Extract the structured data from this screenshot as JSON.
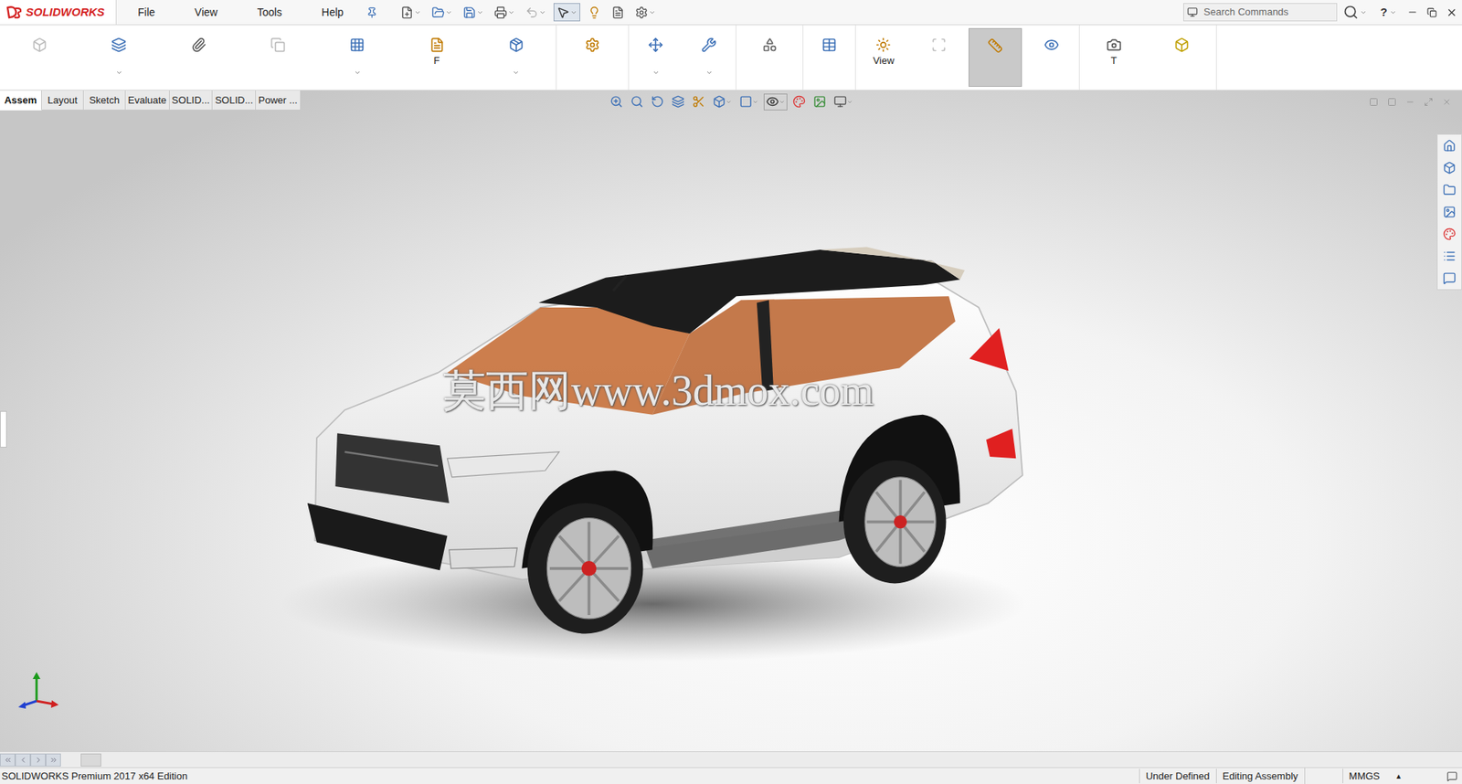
{
  "app": {
    "logo": "SOLIDWORKS"
  },
  "menu": [
    "File",
    "View",
    "Tools",
    "Help"
  ],
  "quick_access": [
    {
      "dropdown": true,
      "selected": false,
      "disabled": false
    },
    {
      "dropdown": true,
      "selected": false,
      "disabled": false
    },
    {
      "dropdown": true,
      "selected": false,
      "disabled": false
    },
    {
      "dropdown": true,
      "selected": false,
      "disabled": false
    },
    {
      "dropdown": true,
      "selected": false,
      "disabled": true
    },
    {
      "dropdown": true,
      "selected": true,
      "disabled": false
    },
    {
      "dropdown": false,
      "selected": false,
      "disabled": false
    },
    {
      "dropdown": false,
      "selected": false,
      "disabled": false
    },
    {
      "dropdown": true,
      "selected": false,
      "disabled": false
    }
  ],
  "search": {
    "placeholder": "Search Commands"
  },
  "help": "?",
  "ribbon": {
    "groups": [
      [
        {
          "dropdown": false,
          "selected": false,
          "disabled": true
        },
        {
          "dropdown": true,
          "selected": false,
          "disabled": false
        },
        {
          "dropdown": false,
          "selected": false,
          "disabled": false
        },
        {
          "dropdown": false,
          "selected": false,
          "disabled": true
        },
        {
          "dropdown": true,
          "selected": false,
          "disabled": false
        },
        {
          "label": "F",
          "dropdown": false,
          "selected": false,
          "disabled": false
        },
        {
          "dropdown": true,
          "selected": false,
          "disabled": false
        }
      ],
      [
        {
          "dropdown": false,
          "selected": false,
          "disabled": false
        }
      ],
      [
        {
          "dropdown": true,
          "selected": false,
          "disabled": false
        },
        {
          "dropdown": true,
          "selected": false,
          "disabled": false
        }
      ],
      [
        {
          "dropdown": false,
          "selected": false,
          "disabled": false
        }
      ],
      [
        {
          "dropdown": false,
          "selected": false,
          "disabled": false
        }
      ],
      [
        {
          "label": "View",
          "dropdown": false,
          "selected": false,
          "disabled": false
        },
        {
          "dropdown": false,
          "selected": false,
          "disabled": true
        },
        {
          "dropdown": false,
          "selected": true,
          "disabled": false
        },
        {
          "dropdown": false,
          "selected": false,
          "disabled": false
        }
      ],
      [
        {
          "label": "T",
          "dropdown": false,
          "selected": false,
          "disabled": false
        },
        {
          "dropdown": false,
          "selected": false,
          "disabled": false
        }
      ]
    ]
  },
  "tabs": [
    {
      "label": "Assem",
      "selected": true
    },
    {
      "label": "Layout",
      "selected": false
    },
    {
      "label": "Sketch",
      "selected": false
    },
    {
      "label": "Evaluate",
      "selected": false
    },
    {
      "label": "SOLID...",
      "selected": false
    },
    {
      "label": "SOLID...",
      "selected": false
    },
    {
      "label": "Power ...",
      "selected": false
    }
  ],
  "heads_up": [
    {
      "dropdown": false,
      "selected": false
    },
    {
      "dropdown": false,
      "selected": false
    },
    {
      "dropdown": false,
      "selected": false
    },
    {
      "dropdown": false,
      "selected": false
    },
    {
      "dropdown": false,
      "selected": false
    },
    {
      "dropdown": true,
      "selected": false
    },
    {
      "dropdown": true,
      "selected": false
    },
    {
      "dropdown": true,
      "selected": true
    },
    {
      "dropdown": false,
      "selected": false
    },
    {
      "dropdown": false,
      "selected": false
    },
    {
      "dropdown": true,
      "selected": false
    }
  ],
  "viewport": {
    "watermark": "莫西网www.3dmox.com"
  },
  "status_bar": {
    "edition": "SOLIDWORKS Premium 2017 x64 Edition",
    "items": [
      "Under Defined",
      "Editing Assembly",
      "MMGS"
    ],
    "units_arrow": "▴"
  }
}
